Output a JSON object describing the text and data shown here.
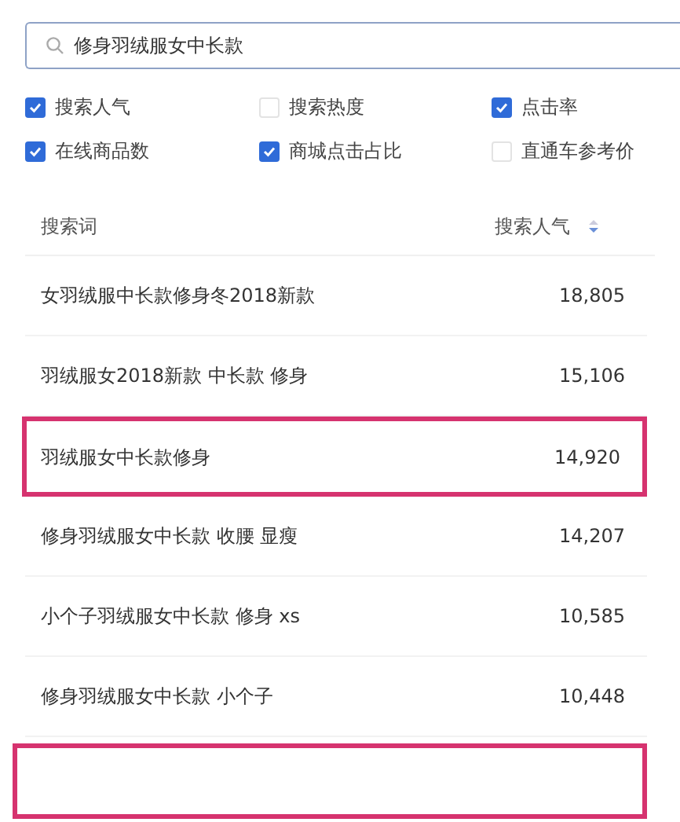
{
  "search": {
    "value": "修身羽绒服女中长款"
  },
  "filters": [
    {
      "label": "搜索人气",
      "checked": true
    },
    {
      "label": "搜索热度",
      "checked": false
    },
    {
      "label": "点击率",
      "checked": true
    },
    {
      "label": "在线商品数",
      "checked": true
    },
    {
      "label": "商城点击占比",
      "checked": true
    },
    {
      "label": "直通车参考价",
      "checked": false
    }
  ],
  "table": {
    "columns": [
      "搜索词",
      "搜索人气"
    ],
    "rows": [
      {
        "keyword": "女羽绒服中长款修身冬2018新款",
        "popularity": "18,805",
        "highlighted": false
      },
      {
        "keyword": "羽绒服女2018新款 中长款 修身",
        "popularity": "15,106",
        "highlighted": false
      },
      {
        "keyword": "羽绒服女中长款修身",
        "popularity": "14,920",
        "highlighted": true
      },
      {
        "keyword": "修身羽绒服女中长款 收腰 显瘦",
        "popularity": "14,207",
        "highlighted": false
      },
      {
        "keyword": "小个子羽绒服女中长款 修身 xs",
        "popularity": "10,585",
        "highlighted": false
      },
      {
        "keyword": "修身羽绒服女中长款 小个子",
        "popularity": "10,448",
        "highlighted": false
      }
    ],
    "partial_row": {
      "highlighted": true
    }
  }
}
